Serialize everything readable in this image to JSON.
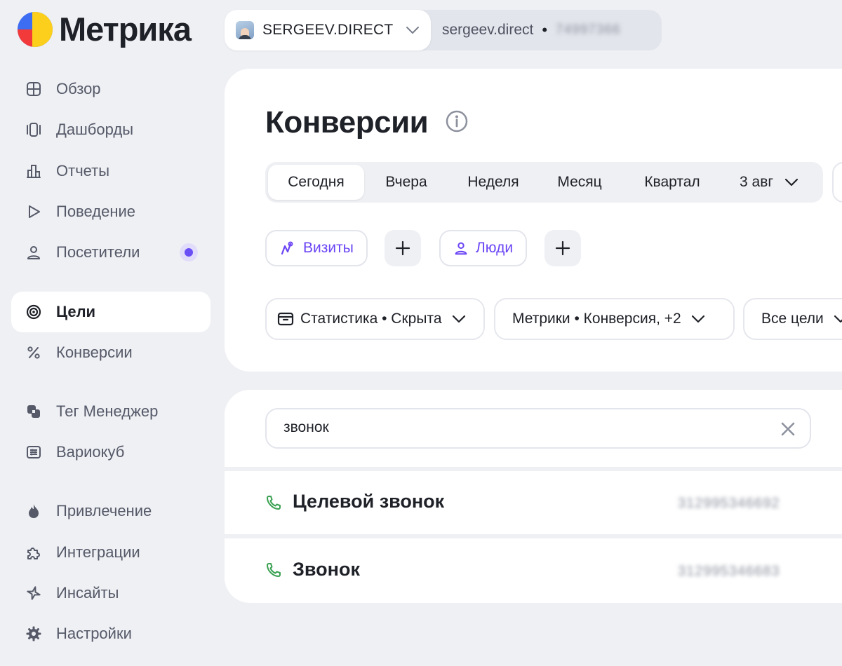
{
  "app": {
    "logo_text": "Метрика"
  },
  "account": {
    "name": "SERGEEV.DIRECT",
    "domain": "sergeev.direct",
    "separator": "•",
    "counter_id": "74997366"
  },
  "sidebar": {
    "items": [
      {
        "label": "Обзор",
        "icon": "grid-icon"
      },
      {
        "label": "Дашборды",
        "icon": "dashboards-icon"
      },
      {
        "label": "Отчеты",
        "icon": "bar-chart-icon"
      },
      {
        "label": "Поведение",
        "icon": "play-icon"
      },
      {
        "label": "Посетители",
        "icon": "person-icon",
        "badge": true
      },
      {
        "label": "Цели",
        "icon": "target-icon",
        "active": true
      },
      {
        "label": "Конверсии",
        "icon": "percent-icon"
      },
      {
        "label": "Тег Менеджер",
        "icon": "tag-manager-icon"
      },
      {
        "label": "Вариокуб",
        "icon": "variocube-icon"
      },
      {
        "label": "Привлечение",
        "icon": "flame-icon"
      },
      {
        "label": "Интеграции",
        "icon": "puzzle-icon"
      },
      {
        "label": "Инсайты",
        "icon": "sparkle-icon"
      },
      {
        "label": "Настройки",
        "icon": "gear-icon"
      }
    ]
  },
  "page": {
    "title": "Конверсии"
  },
  "period": {
    "tabs": [
      "Сегодня",
      "Вчера",
      "Неделя",
      "Месяц",
      "Квартал"
    ],
    "active": "Сегодня",
    "date": "3 авг"
  },
  "segments": {
    "visits_label": "Визиты",
    "people_label": "Люди"
  },
  "filters": {
    "statistics": "Статистика • Скрыта",
    "metrics": "Метрики • Конверсия, +2",
    "goals": "Все цели"
  },
  "search": {
    "value": "звонок"
  },
  "goals": [
    {
      "name": "Целевой звонок",
      "id": "312995346692"
    },
    {
      "name": "Звонок",
      "id": "312995346683"
    }
  ],
  "colors": {
    "accent": "#6b45f5",
    "phone": "#3aa152",
    "background": "#eff0f4"
  }
}
